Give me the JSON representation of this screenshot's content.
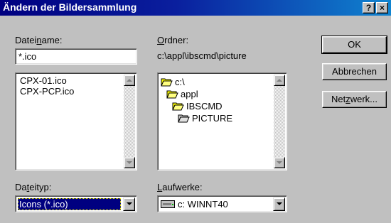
{
  "window": {
    "title": "Ändern der Bildersammlung",
    "help_glyph": "?",
    "close_glyph": "×"
  },
  "filename": {
    "label_pre": "Datei",
    "label_accel": "n",
    "label_post": "ame:",
    "value": "*.ico",
    "files": [
      "CPX-01.ico",
      "CPX-PCP.ico"
    ]
  },
  "folder": {
    "label_accel": "O",
    "label_post": "rdner:",
    "path": "c:\\appl\\ibscmd\\picture",
    "tree": [
      {
        "name": "c:\\",
        "icon": "open-folder-icon"
      },
      {
        "name": "appl",
        "icon": "open-folder-icon"
      },
      {
        "name": "IBSCMD",
        "icon": "open-folder-icon"
      },
      {
        "name": "PICTURE",
        "icon": "open-folder-icon"
      }
    ]
  },
  "filetype": {
    "label_pre": "Da",
    "label_accel": "t",
    "label_post": "eityp:",
    "selected": "Icons (*.ico)"
  },
  "drives": {
    "label_accel": "L",
    "label_post": "aufwerke:",
    "selected": "c: WINNT40",
    "icon": "hard-drive-icon"
  },
  "buttons": {
    "ok": "OK",
    "cancel": "Abbrechen",
    "network_pre": "Net",
    "network_accel": "z",
    "network_post": "werk..."
  }
}
